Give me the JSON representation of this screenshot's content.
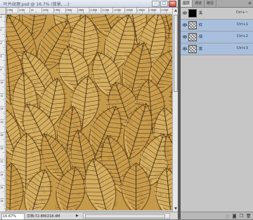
{
  "document": {
    "title": "叶片纹理.psd @ 16.7% (背景, ...)",
    "zoom": "16.67%",
    "doc_info": "文档:72.8M/218.4M",
    "ruler_top_numbers": [
      "|400",
      "|200",
      "|0",
      "|200",
      "|400",
      "|600",
      "|800",
      "|1000",
      "|1200",
      "|1400",
      "|1600",
      "|1800",
      "|2000",
      "|2200"
    ],
    "ruler_left_numbers": [
      "0",
      "2",
      "4",
      "6",
      "8",
      "10",
      "12",
      "14",
      "16",
      "18",
      "20",
      "22",
      "24",
      "26",
      "28"
    ],
    "canvas_colors": {
      "base": "#c59a4a",
      "vein": "#3d2a12",
      "highlight": "#f0d28a",
      "shadow": "#7a5420"
    }
  },
  "window_controls": {
    "minimize": "–",
    "maximize": "□",
    "close": "×"
  },
  "status": {
    "arrow": "▶"
  },
  "panel": {
    "tabs": [
      {
        "label": "图层",
        "active": true
      },
      {
        "label": "通道",
        "active": false
      },
      {
        "label": "路径",
        "active": false
      }
    ],
    "menu_icon": "≡",
    "layers": [
      {
        "name": "黑",
        "shortcut": "Ctrl+~",
        "thumb": "black",
        "selected": false
      },
      {
        "name": "红",
        "shortcut": "Ctrl+1",
        "thumb": "pattern",
        "selected": true
      },
      {
        "name": "绿",
        "shortcut": "Ctrl+2",
        "thumb": "pattern",
        "selected": true
      },
      {
        "name": "蓝",
        "shortcut": "Ctrl+3",
        "thumb": "pattern",
        "selected": true
      }
    ],
    "footer_icons": [
      "dotted-circle-icon",
      "mask-icon",
      "new-icon",
      "trash-icon"
    ],
    "footer_glyphs": [
      "◌",
      "◙",
      "❐",
      "🗑"
    ]
  },
  "colors": {
    "selected_row": "#a8bfde",
    "panel_bg": "#c3c3c3"
  }
}
